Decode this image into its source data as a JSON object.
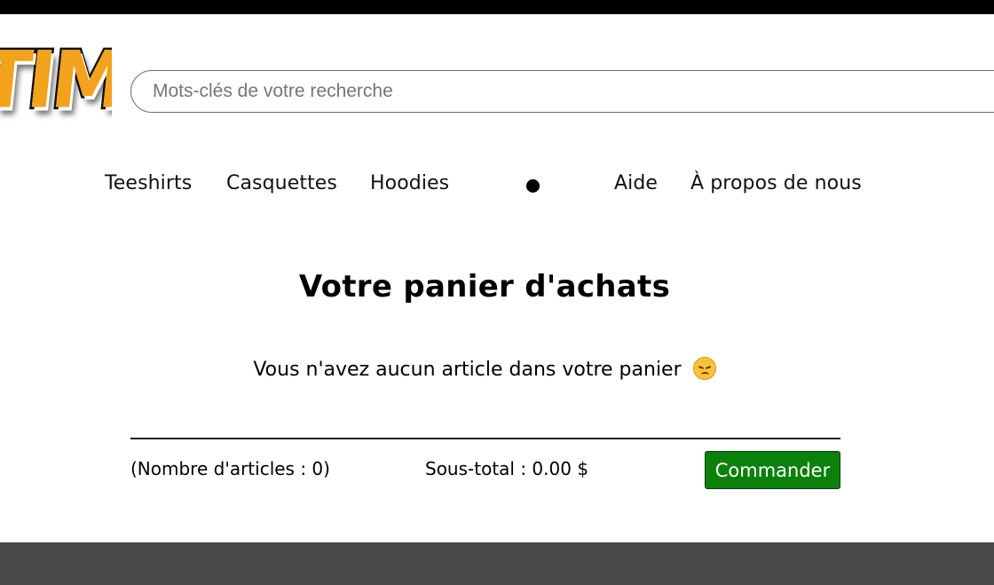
{
  "header": {
    "logo_text": "TIM",
    "search": {
      "placeholder": "Mots-clés de votre recherche",
      "value": ""
    }
  },
  "nav": {
    "items": [
      {
        "label": "Teeshirts"
      },
      {
        "label": "Casquettes"
      },
      {
        "label": "Hoodies"
      },
      {
        "label": "Aide"
      },
      {
        "label": "À propos de nous"
      }
    ]
  },
  "cart": {
    "title": "Votre panier d'achats",
    "empty_message": "Vous n'avez aucun article dans votre panier",
    "empty_emoji": "pensive-face-icon",
    "item_count_text": "(Nombre d'articles : 0)",
    "subtotal_text": "Sous-total : 0.00 $",
    "checkout_label": "Commander"
  },
  "colors": {
    "checkout_button": "#0b800b",
    "footer": "#4a4a4a",
    "logo_fill": "#f3a21c"
  }
}
